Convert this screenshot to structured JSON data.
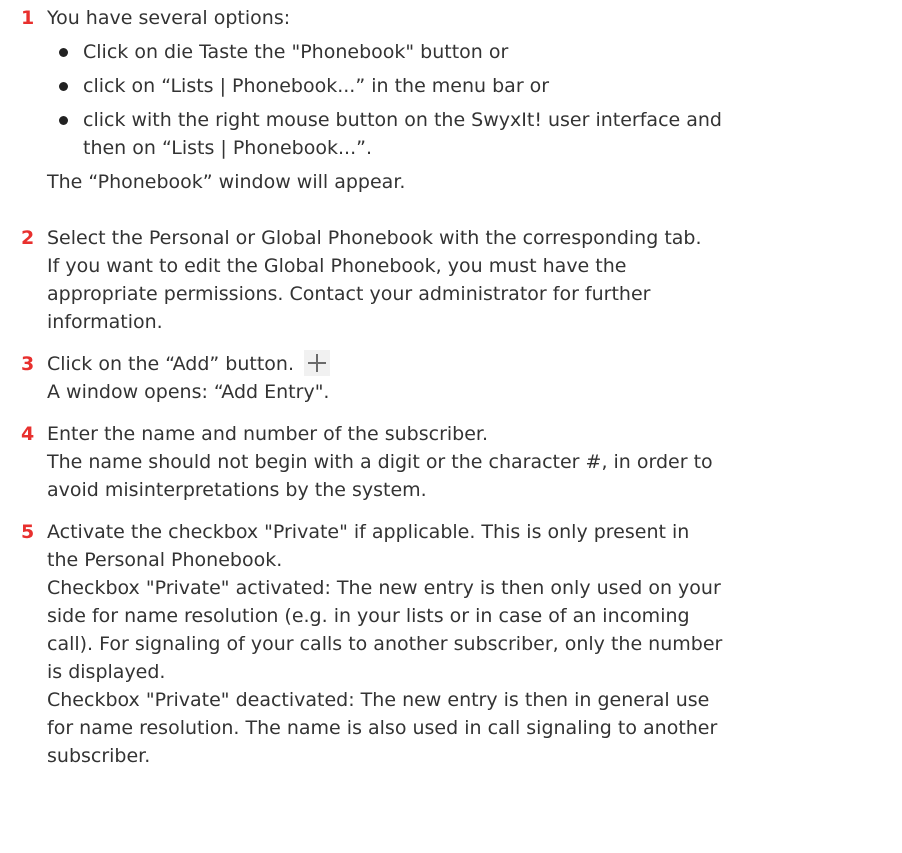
{
  "steps": [
    {
      "number": "1",
      "intro": "You have several options:",
      "bullets": [
        [
          "Click on die Taste the \"Phonebook\" button or"
        ],
        [
          "click on “Lists | Phonebook...” in the menu bar or"
        ],
        [
          "click with the right mouse button on the SwyxIt! user interface and",
          "then on “Lists | Phonebook...”."
        ]
      ],
      "outro": "The “Phonebook” window will appear."
    },
    {
      "number": "2",
      "lines": [
        "Select the Personal or Global Phonebook with the corresponding tab.",
        "If you want to edit the Global Phonebook, you must have the",
        "appropriate permissions. Contact your administrator for further",
        "information."
      ]
    },
    {
      "number": "3",
      "line1": "Click on the “Add” button.",
      "icon": "plus-icon",
      "line2": "A window opens: “Add Entry\"."
    },
    {
      "number": "4",
      "lines": [
        "Enter the name and number of the subscriber.",
        "The name should not begin with a digit or the character #, in order to",
        "avoid misinterpretations by the system."
      ]
    },
    {
      "number": "5",
      "lines": [
        "Activate the checkbox \"Private\" if applicable. This is only present in",
        "the Personal Phonebook.",
        "Checkbox \"Private\" activated: The new entry is then only used on your",
        "side for name resolution (e.g. in your lists or in case of an incoming",
        "call). For signaling of your calls to another subscriber, only the number",
        "is displayed.",
        "Checkbox \"Private\" deactivated: The new entry is then in general use",
        "for name resolution. The name is also used in call signaling to another",
        "subscriber."
      ]
    }
  ]
}
